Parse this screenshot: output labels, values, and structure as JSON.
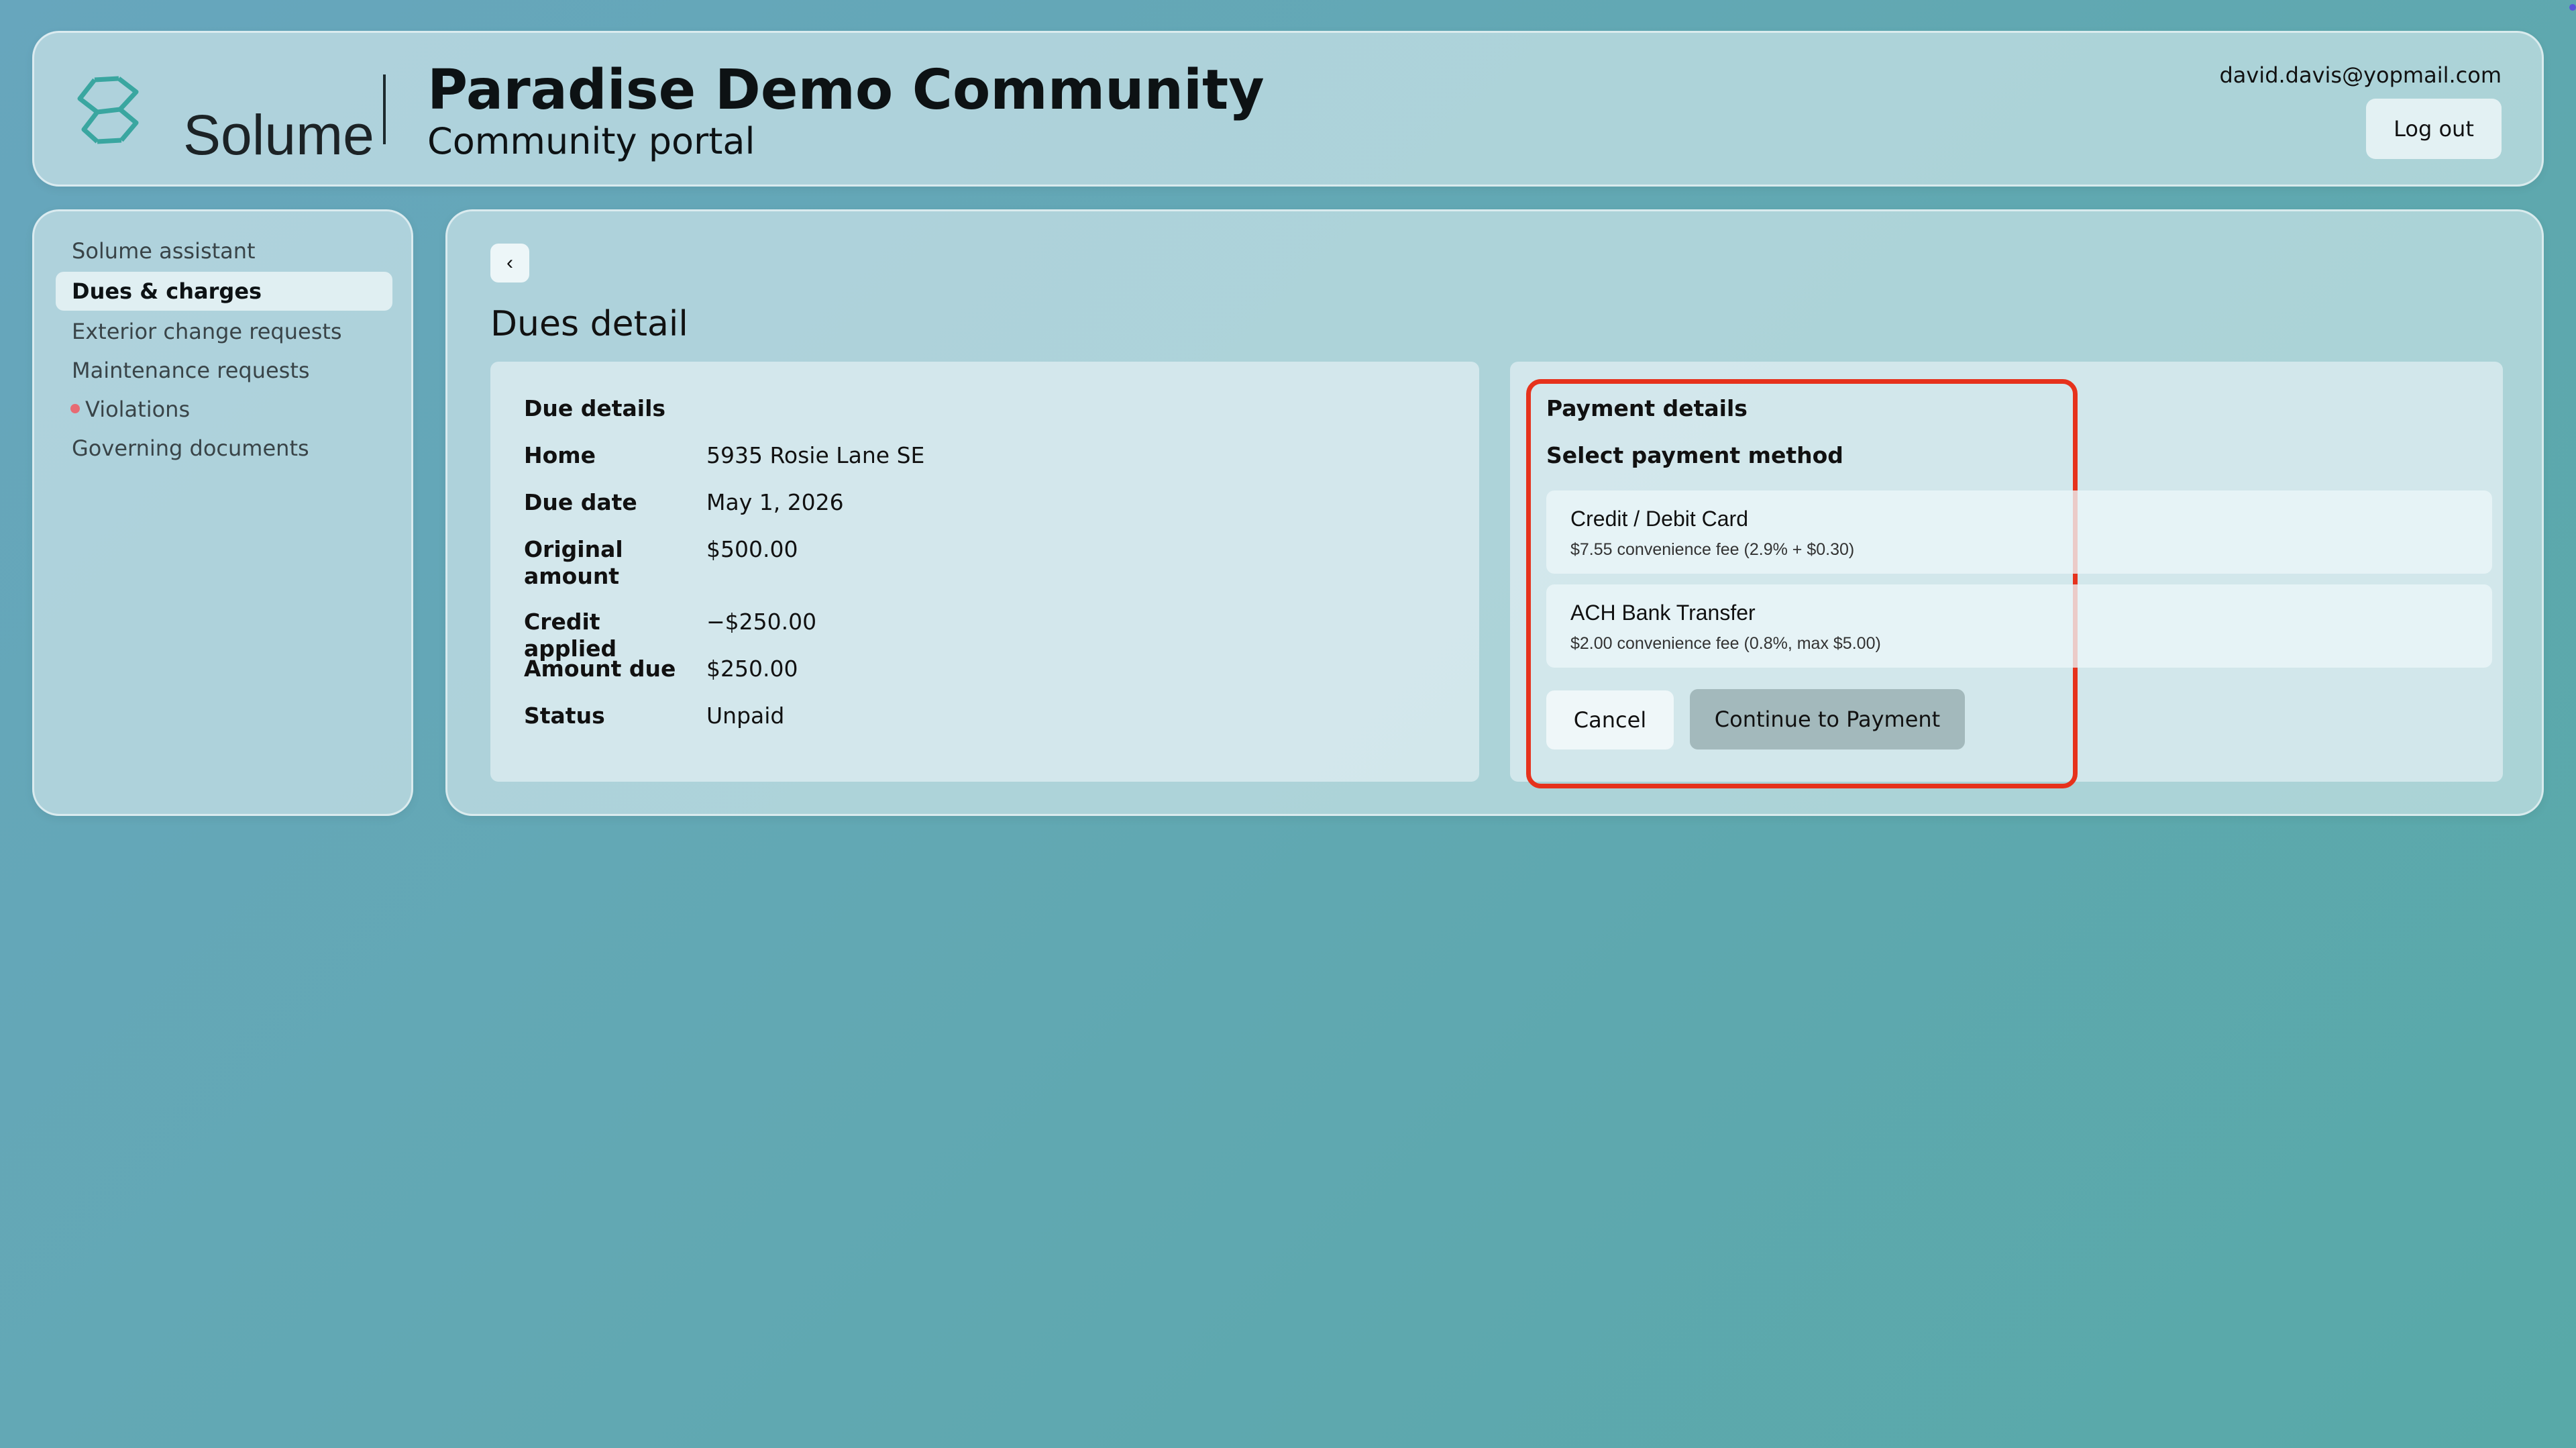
{
  "header": {
    "brand": "Solume",
    "community_name": "Paradise Demo Community",
    "portal_label": "Community portal",
    "user_email": "david.davis@yopmail.com",
    "logout_label": "Log out",
    "logo_icon": "solume-logo-icon",
    "brand_color": "#3aa6a0"
  },
  "sidebar": {
    "items": [
      {
        "label": "Solume assistant",
        "active": false
      },
      {
        "label": "Dues & charges",
        "active": true
      },
      {
        "label": "Exterior change requests",
        "active": false
      },
      {
        "label": "Maintenance requests",
        "active": false
      },
      {
        "label": "Violations",
        "active": false,
        "alert_dot": true
      },
      {
        "label": "Governing documents",
        "active": false
      }
    ],
    "alert_color": "#e76b73"
  },
  "main": {
    "back_icon": "chevron-left-icon",
    "back_glyph": "‹",
    "page_title": "Dues detail",
    "due_details": {
      "title": "Due details",
      "rows": [
        {
          "label": "Home",
          "value": "5935 Rosie Lane SE"
        },
        {
          "label": "Due date",
          "value": "May 1, 2026"
        },
        {
          "label": "Original amount",
          "value": "$500.00"
        },
        {
          "label": "Credit applied",
          "value": "−$250.00"
        },
        {
          "label": "Amount due",
          "value": "$250.00"
        },
        {
          "label": "Status",
          "value": "Unpaid"
        }
      ]
    },
    "payment_details": {
      "title": "Payment details",
      "subtitle": "Select payment method",
      "methods": [
        {
          "name": "Credit / Debit Card",
          "fee": "$7.55 convenience fee (2.9% + $0.30)"
        },
        {
          "name": "ACH Bank Transfer",
          "fee": "$2.00 convenience fee (0.8%, max $5.00)"
        }
      ],
      "cancel_label": "Cancel",
      "continue_label": "Continue to Payment",
      "highlight_color": "#e6321c"
    }
  }
}
